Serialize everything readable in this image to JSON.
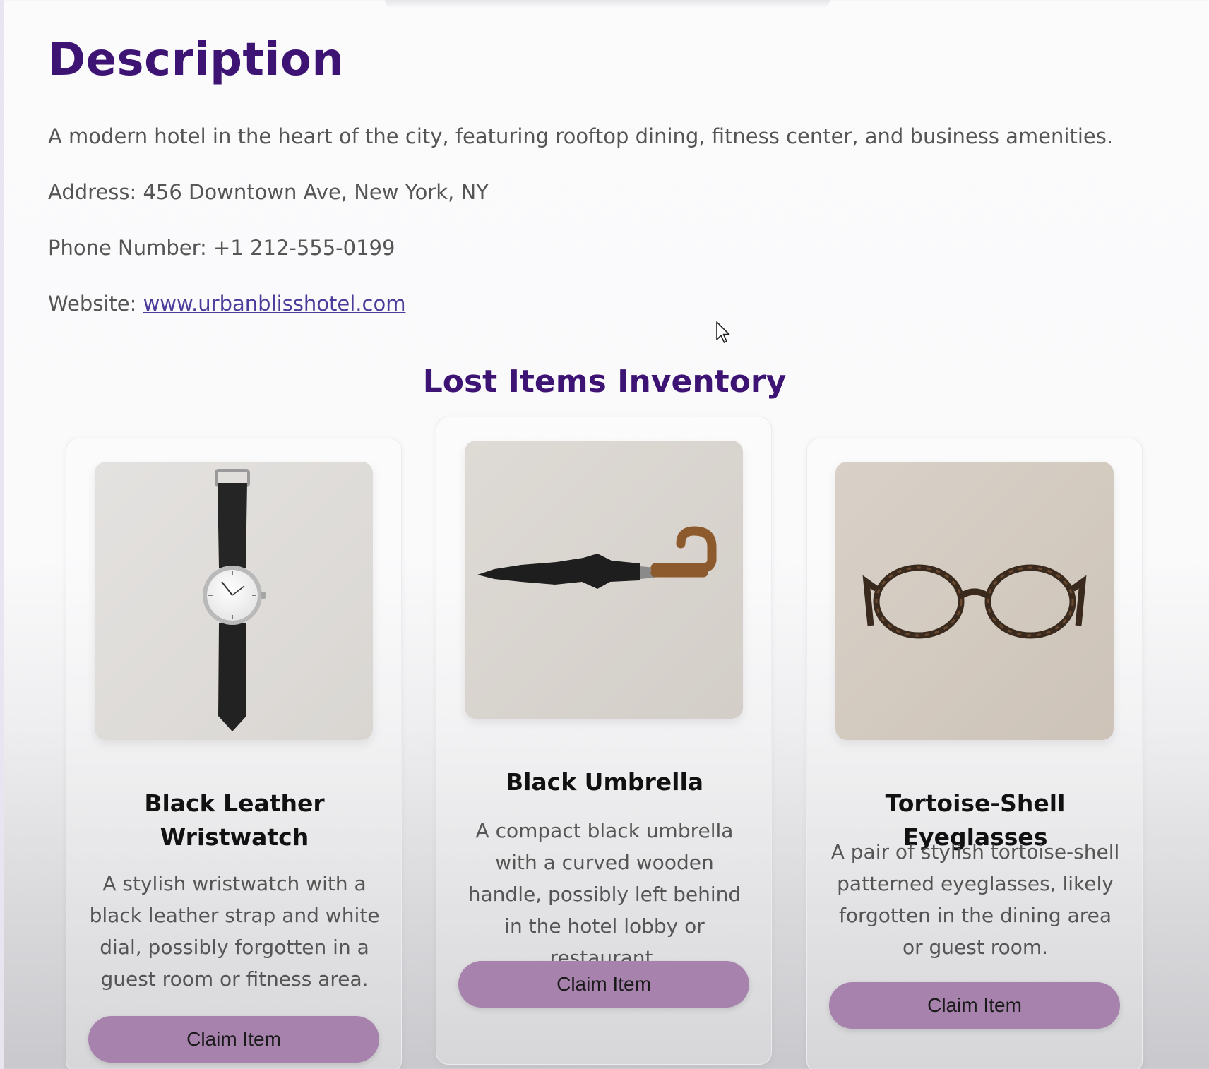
{
  "description": {
    "title": "Description",
    "summary": "A modern hotel in the heart of the city, featuring rooftop dining, fitness center, and business amenities.",
    "address_label": "Address:",
    "address": "456 Downtown Ave, New York, NY",
    "phone_label": "Phone Number:",
    "phone": "+1 212-555-0199",
    "website_label": "Website:",
    "website": "www.urbanblisshotel.com"
  },
  "inventory": {
    "title": "Lost Items Inventory",
    "items": [
      {
        "name": "Black Leather Wristwatch",
        "description": "A stylish wristwatch with a black leather strap and white dial, possibly forgotten in a guest room or fitness area.",
        "button": "Claim Item",
        "image_icon": "wristwatch-photo"
      },
      {
        "name": "Black Umbrella",
        "description": "A compact black umbrella with a curved wooden handle, possibly left behind in the hotel lobby or restaurant.",
        "button": "Claim Item",
        "image_icon": "umbrella-photo"
      },
      {
        "name": "Tortoise-Shell Eyeglasses",
        "description": "A pair of stylish tortoise-shell patterned eyeglasses, likely forgotten in the dining area or guest room.",
        "button": "Claim Item",
        "image_icon": "eyeglasses-photo"
      }
    ]
  },
  "colors": {
    "heading": "#3d1373",
    "button": "#a682ad",
    "body_text": "#555555",
    "link": "#4a3c9a"
  }
}
